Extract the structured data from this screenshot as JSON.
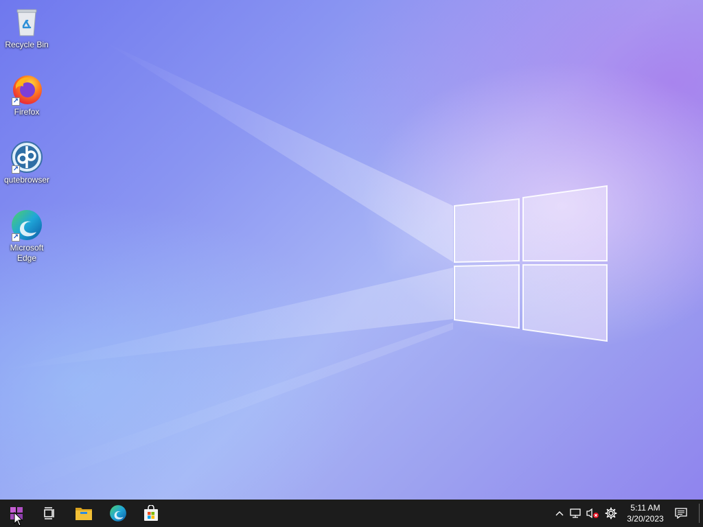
{
  "desktop": {
    "icons": [
      {
        "label": "Recycle Bin",
        "icon": "recycle-bin-icon"
      },
      {
        "label": "Firefox",
        "icon": "firefox-icon",
        "shortcut": true
      },
      {
        "label": "qutebrowser",
        "icon": "qutebrowser-icon",
        "shortcut": true
      },
      {
        "label": "Microsoft Edge",
        "icon": "edge-icon",
        "shortcut": true
      }
    ],
    "shortcut_glyph": "↗"
  },
  "taskbar": {
    "start_icon": "windows-start-icon",
    "pinned": [
      "task-view-icon",
      "file-explorer-icon",
      "edge-icon",
      "microsoft-store-icon"
    ],
    "tray": {
      "chevron_glyph": "^",
      "icons": [
        "network-icon",
        "volume-muted-icon",
        "settings-gear-icon"
      ],
      "time": "5:11 AM",
      "date": "3/20/2023",
      "notification_icon": "action-center-icon"
    }
  },
  "colors": {
    "taskbar": "#1c1c1c",
    "start_accent": "#b14fc5",
    "edge_blue": "#1b8fd6",
    "edge_green": "#4fd06a",
    "folder_yellow": "#f2c037"
  }
}
